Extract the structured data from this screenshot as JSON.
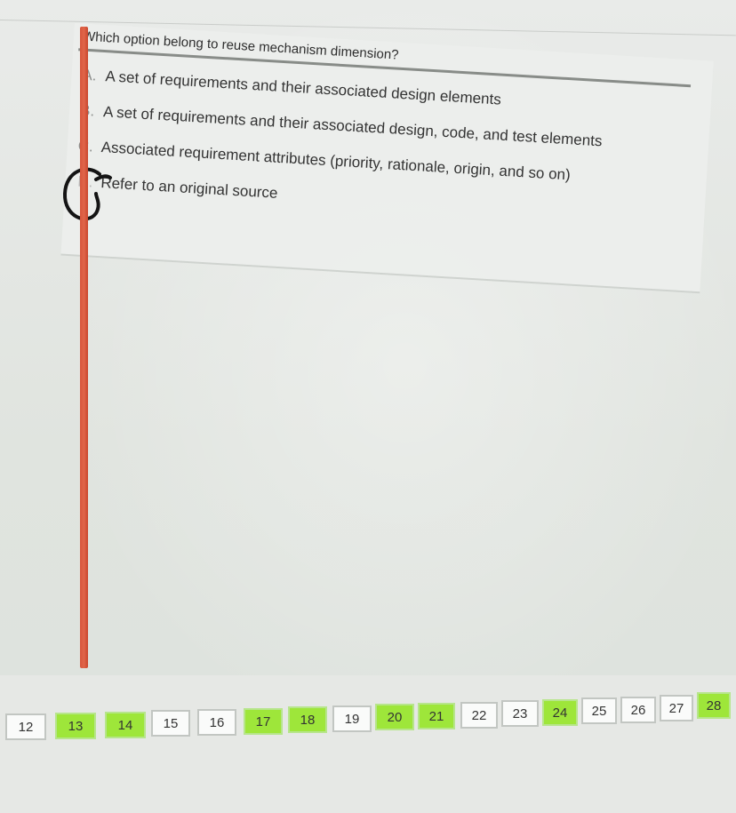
{
  "question": {
    "text": "Which option belong to reuse mechanism dimension?",
    "options": [
      {
        "letter": "A.",
        "text": "A set of requirements and their associated design elements"
      },
      {
        "letter": "B.",
        "text": "A set of requirements and their associated design, code, and test elements"
      },
      {
        "letter": "C.",
        "text": "Associated requirement attributes (priority, rationale, origin, and so on)"
      },
      {
        "letter": "D.",
        "text": "Refer to an original source"
      }
    ],
    "marked_option": "D"
  },
  "navigator": {
    "items": [
      {
        "label": "12",
        "answered": false
      },
      {
        "label": "13",
        "answered": true
      },
      {
        "label": "14",
        "answered": true
      },
      {
        "label": "15",
        "answered": false
      },
      {
        "label": "16",
        "answered": false
      },
      {
        "label": "17",
        "answered": true
      },
      {
        "label": "18",
        "answered": true
      },
      {
        "label": "19",
        "answered": false
      },
      {
        "label": "20",
        "answered": true
      },
      {
        "label": "21",
        "answered": true
      },
      {
        "label": "22",
        "answered": false
      },
      {
        "label": "23",
        "answered": false
      },
      {
        "label": "24",
        "answered": true
      },
      {
        "label": "25",
        "answered": false
      },
      {
        "label": "26",
        "answered": false
      },
      {
        "label": "27",
        "answered": false
      },
      {
        "label": "28",
        "answered": true
      }
    ]
  },
  "colors": {
    "answered": "#9ee63a",
    "unanswered": "#fafbfa",
    "accent_bar": "#d7553a"
  }
}
